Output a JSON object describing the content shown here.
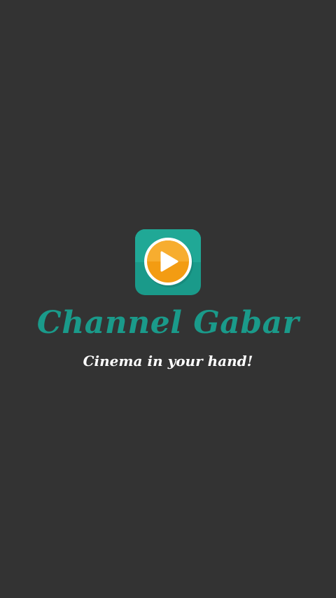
{
  "splash": {
    "title": "Channel Gabar",
    "tagline": "Cinema in your hand!",
    "icon": "play-button-icon"
  },
  "colors": {
    "background": "#333333",
    "accent": "#1a9a8a",
    "icon_orange": "#f39c12",
    "text_white": "#ffffff"
  }
}
